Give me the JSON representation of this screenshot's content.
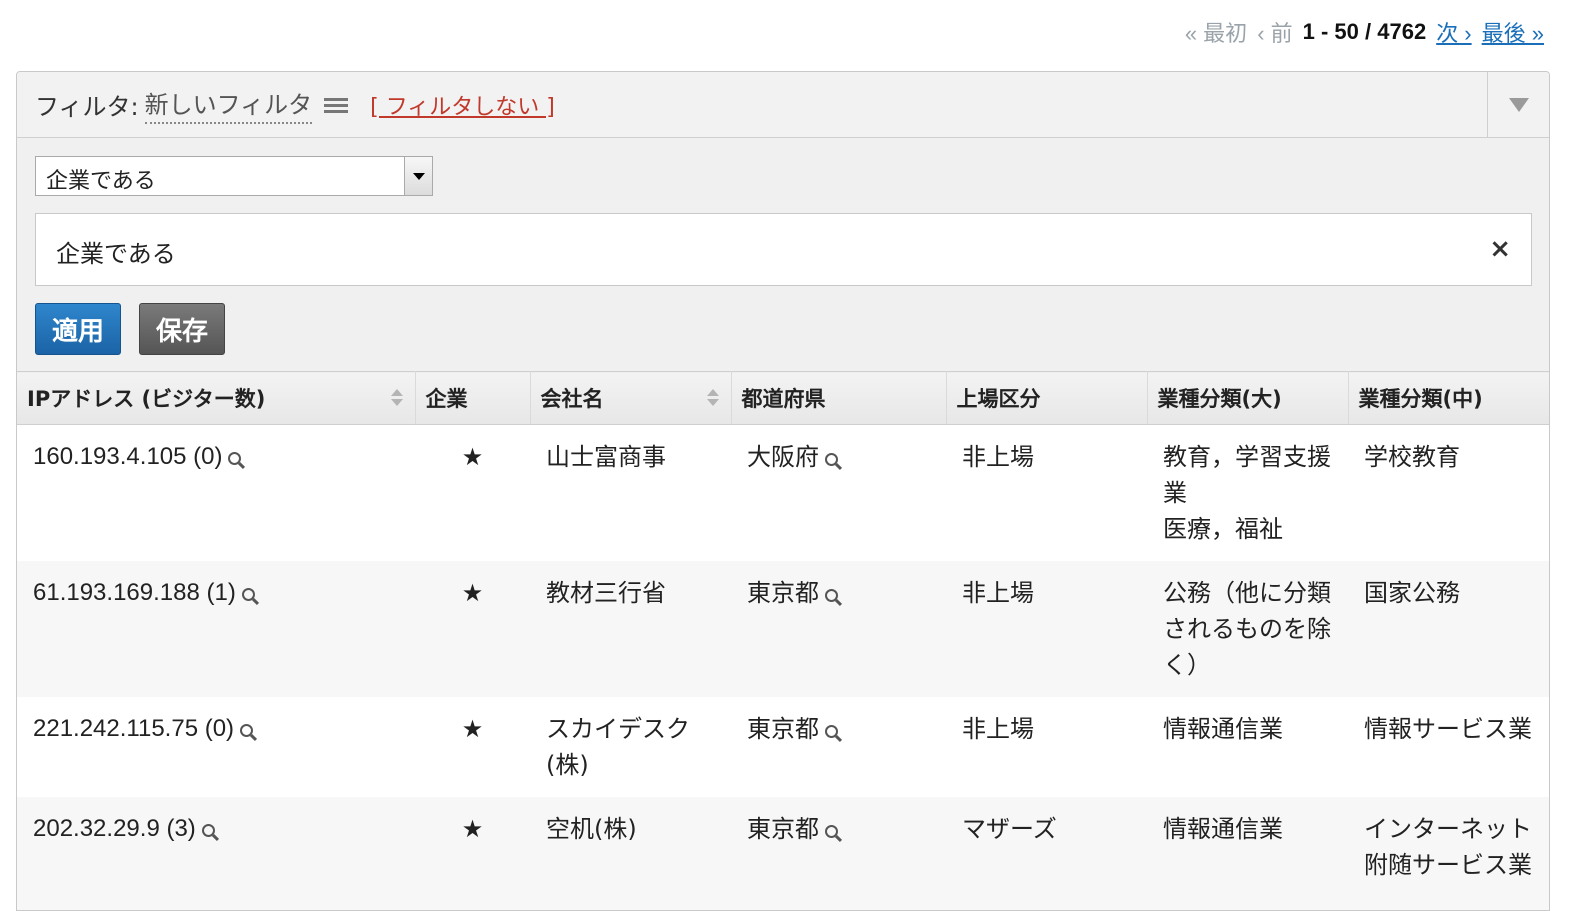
{
  "pager": {
    "first": "« 最初",
    "prev": "‹ 前",
    "range": "1 - 50 / 4762",
    "next": "次 ›",
    "last": "最後 »"
  },
  "filter": {
    "label": "フィルタ:",
    "name": "新しいフィルタ",
    "no_filter": "[ フィルタしない ]",
    "select_value": "企業である",
    "condition": "企業である",
    "remove": "×",
    "apply": "適用",
    "save": "保存"
  },
  "table": {
    "headers": [
      "IPアドレス (ビジター数)",
      "企業",
      "会社名",
      "都道府県",
      "上場区分",
      "業種分類(大)",
      "業種分類(中)"
    ],
    "rows": [
      {
        "ip": "160.193.4.105 (0)",
        "star": "★",
        "company": "山士富商事",
        "pref": "大阪府",
        "listing": "非上場",
        "large": "教育，学習支援業\n医療，福祉",
        "medium": "学校教育"
      },
      {
        "ip": "61.193.169.188 (1)",
        "star": "★",
        "company": "教材三行省",
        "pref": "東京都",
        "listing": "非上場",
        "large": "公務（他に分類されるものを除く）",
        "medium": "国家公務"
      },
      {
        "ip": "221.242.115.75 (0)",
        "star": "★",
        "company": "スカイデスク(株)",
        "pref": "東京都",
        "listing": "非上場",
        "large": "情報通信業",
        "medium": "情報サービス業"
      },
      {
        "ip": "202.32.29.9 (3)",
        "star": "★",
        "company": "空机(株)",
        "pref": "東京都",
        "listing": "マザーズ",
        "large": "情報通信業",
        "medium": "インターネット附随サービス業"
      }
    ]
  },
  "colors": {
    "accent": "#1a6fb8",
    "star": "#1e9e2e",
    "nofilter": "#c0392b"
  }
}
